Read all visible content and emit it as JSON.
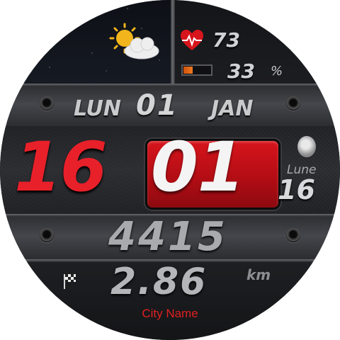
{
  "weather": {
    "icon": "partly-cloudy-icon"
  },
  "heart_rate": {
    "icon": "heart-pulse-icon",
    "value": "73"
  },
  "battery": {
    "icon": "battery-icon",
    "level_percent": 33,
    "value": "33",
    "unit": "%"
  },
  "date": {
    "weekday": "LUN",
    "day": "01",
    "month": "JAN"
  },
  "time": {
    "hour": "16",
    "minute": "01"
  },
  "moon": {
    "icon": "moon-phase-icon",
    "label": "Lune",
    "value": "16"
  },
  "steps": {
    "value": "4415"
  },
  "distance": {
    "icon": "checkered-flag-icon",
    "value": "2.86",
    "unit": "km"
  },
  "location": {
    "city": "City Name"
  },
  "colors": {
    "accent_red": "#e8202a",
    "minute_box": "#c8121a",
    "battery_orange": "#f07a20",
    "city_text": "#e02020"
  }
}
